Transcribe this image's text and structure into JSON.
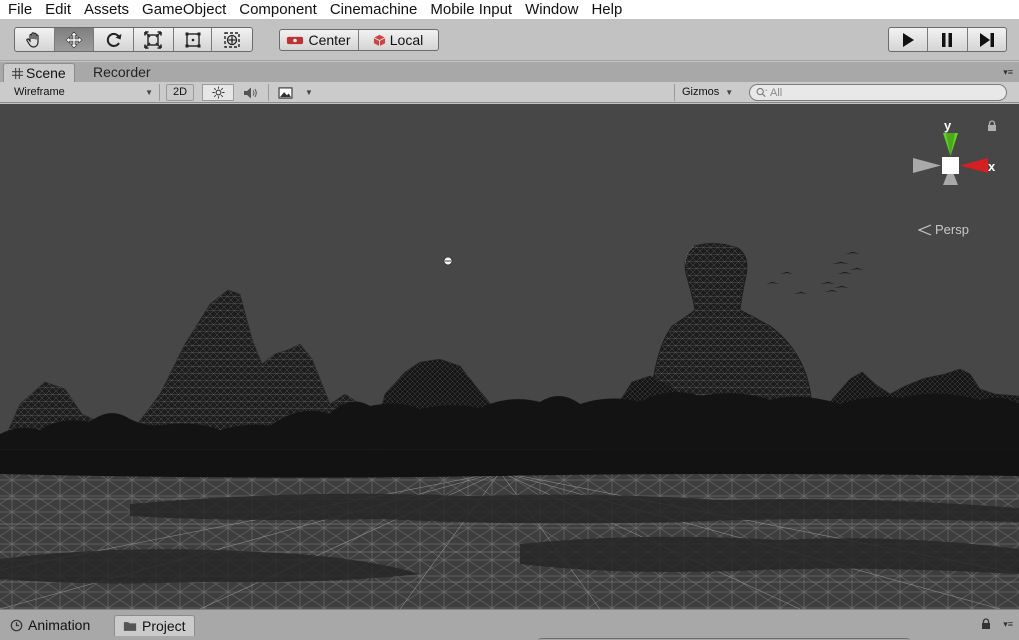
{
  "menu": [
    "File",
    "Edit",
    "Assets",
    "GameObject",
    "Component",
    "Cinemachine",
    "Mobile Input",
    "Window",
    "Help"
  ],
  "toolbar": {
    "tools": [
      {
        "name": "hand-tool",
        "icon": "hand-icon",
        "active": false
      },
      {
        "name": "move-tool",
        "icon": "move-arrows-icon",
        "active": true
      },
      {
        "name": "rotate-tool",
        "icon": "rotate-icon",
        "active": false
      },
      {
        "name": "scale-tool",
        "icon": "scale-icon",
        "active": false
      },
      {
        "name": "rect-tool",
        "icon": "rect-transform-icon",
        "active": false
      },
      {
        "name": "transform-tool",
        "icon": "combined-transform-icon",
        "active": false
      }
    ],
    "pivot_label": "Center",
    "rotation_label": "Local",
    "playback": [
      "play-icon",
      "pause-icon",
      "step-icon"
    ]
  },
  "scene_tabs": {
    "active": "Scene",
    "inactive": "Recorder"
  },
  "scene_toolbar": {
    "draw_mode": "Wireframe",
    "mode_2d": "2D",
    "gizmos": "Gizmos",
    "search_placeholder": "All"
  },
  "gizmo": {
    "y_label": "y",
    "x_label": "x",
    "projection": "Persp",
    "colors": {
      "y": "#64d02a",
      "x": "#d42020",
      "neutral": "#a9a9a9"
    }
  },
  "bottom_tabs": {
    "inactive": "Animation",
    "active": "Project"
  }
}
